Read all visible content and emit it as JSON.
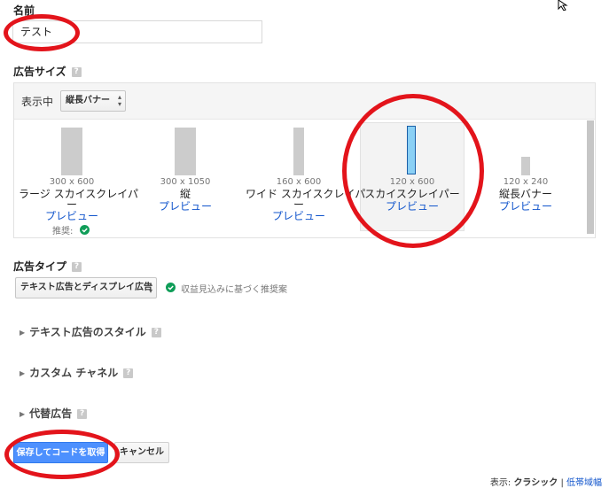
{
  "name_section": {
    "label": "名前",
    "value": "テスト"
  },
  "ad_size": {
    "label": "広告サイズ",
    "help": "?",
    "display_label": "表示中",
    "display_select": "縦長バナー",
    "items": [
      {
        "dim": "300 x 600",
        "name1": "ラージ スカイスクレイパ",
        "name2": "ー",
        "preview": "プレビュー",
        "recommended": "推奨:"
      },
      {
        "dim": "300 x 1050",
        "name1": "縦",
        "name2": "",
        "preview": "プレビュー",
        "recommended": ""
      },
      {
        "dim": "160 x 600",
        "name1": "ワイド スカイスクレイパ",
        "name2": "ー",
        "preview": "プレビュー",
        "recommended": ""
      },
      {
        "dim": "120 x 600",
        "name1": "スカイスクレイパー",
        "name2": "",
        "preview": "プレビュー",
        "recommended": ""
      },
      {
        "dim": "120 x 240",
        "name1": "縦長バナー",
        "name2": "",
        "preview": "プレビュー",
        "recommended": ""
      }
    ]
  },
  "ad_type": {
    "label": "広告タイプ",
    "help": "?",
    "select": "テキスト広告とディスプレイ広告",
    "note": "収益見込みに基づく推奨案"
  },
  "sections": [
    {
      "label": "テキスト広告のスタイル",
      "help": "?"
    },
    {
      "label": "カスタム チャネル",
      "help": "?"
    },
    {
      "label": "代替広告",
      "help": "?"
    }
  ],
  "buttons": {
    "save": "保存してコードを取得",
    "cancel": "キャンセル"
  },
  "footer": {
    "prefix": "表示:",
    "current": "クラシック",
    "separator": "|",
    "alt": "低帯域幅"
  },
  "colors": {
    "accent": "#4d90fe",
    "link": "#1155cc",
    "annotation": "#e3141b",
    "selected_bar": "#8ad0f5"
  }
}
